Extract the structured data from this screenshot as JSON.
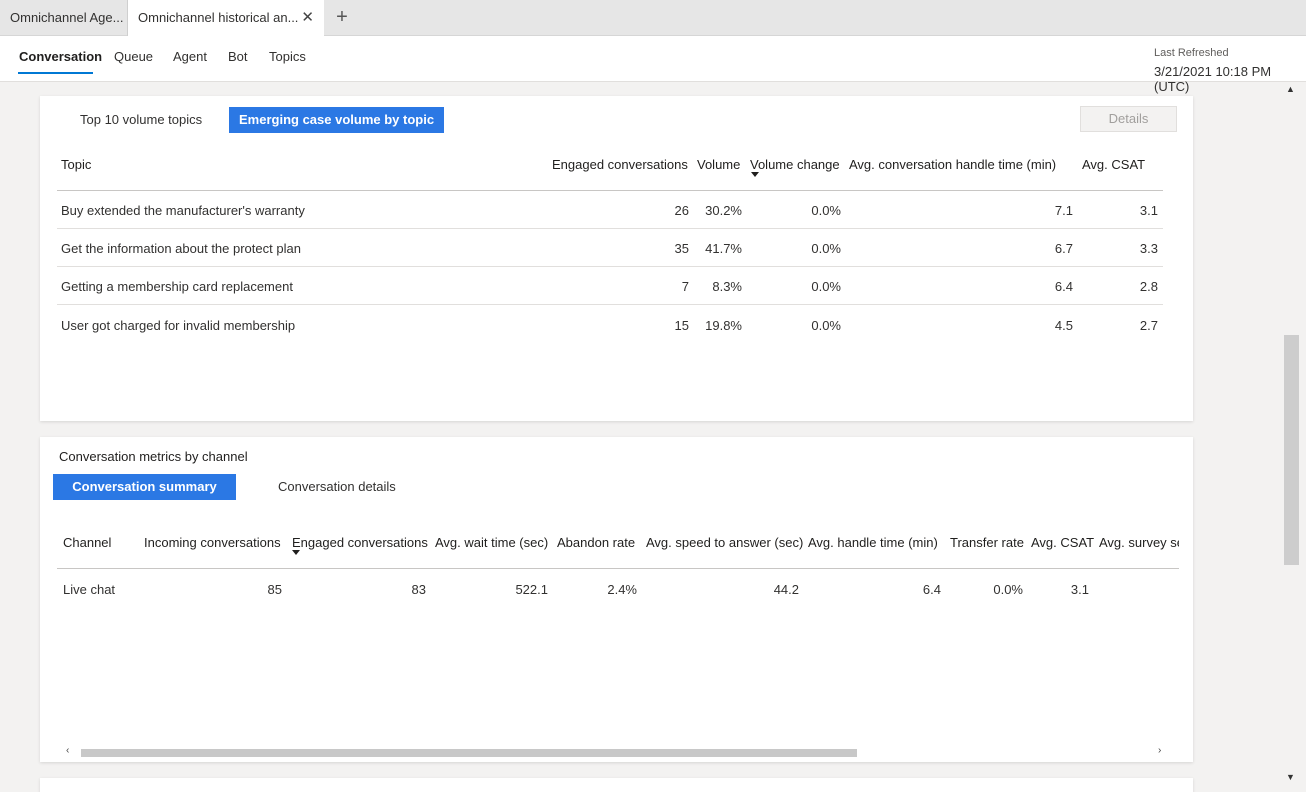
{
  "browser_tabs": [
    {
      "label": "Omnichannel Age..."
    },
    {
      "label": "Omnichannel historical an..."
    }
  ],
  "header": {
    "nav": [
      "Conversation",
      "Queue",
      "Agent",
      "Bot",
      "Topics"
    ],
    "last_refreshed_label": "Last Refreshed",
    "last_refreshed_value": "3/21/2021 10:18 PM (UTC)"
  },
  "topics_card": {
    "tabs": [
      "Top 10 volume topics",
      "Emerging case volume by topic"
    ],
    "active_tab": 1,
    "details_label": "Details",
    "columns": [
      "Topic",
      "Engaged conversations",
      "Volume",
      "Volume change",
      "Avg. conversation handle time (min)",
      "Avg. CSAT"
    ],
    "sorted_column": "Volume change",
    "rows": [
      [
        "Buy extended the manufacturer's warranty",
        "26",
        "30.2%",
        "0.0%",
        "7.1",
        "3.1"
      ],
      [
        "Get the information about the protect plan",
        "35",
        "41.7%",
        "0.0%",
        "6.7",
        "3.3"
      ],
      [
        "Getting a membership card replacement",
        "7",
        "8.3%",
        "0.0%",
        "6.4",
        "2.8"
      ],
      [
        "User got charged for invalid membership",
        "15",
        "19.8%",
        "0.0%",
        "4.5",
        "2.7"
      ]
    ]
  },
  "channel_card": {
    "title": "Conversation metrics by channel",
    "tabs": [
      "Conversation summary",
      "Conversation details"
    ],
    "active_tab": 0,
    "columns": [
      "Channel",
      "Incoming conversations",
      "Engaged conversations",
      "Avg. wait time (sec)",
      "Abandon rate",
      "Avg. speed to answer (sec)",
      "Avg. handle time (min)",
      "Transfer rate",
      "Avg. CSAT",
      "Avg. survey se"
    ],
    "sorted_column": "Engaged conversations",
    "rows": [
      [
        "Live chat",
        "85",
        "83",
        "522.1",
        "2.4%",
        "44.2",
        "6.4",
        "0.0%",
        "3.1",
        ""
      ]
    ]
  },
  "colors": {
    "accent": "#0078d4",
    "active_pill": "#2b78e4"
  },
  "icons": {
    "close": "close-icon",
    "new_tab": "plus-icon",
    "sort": "sort-desc-icon"
  }
}
